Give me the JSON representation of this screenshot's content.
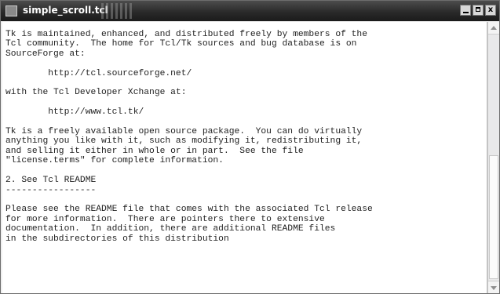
{
  "window": {
    "title": "simple_scroll.tcl",
    "icon": "tk-app-icon",
    "buttons": [
      "minimize",
      "maximize",
      "close"
    ],
    "close_label": "x"
  },
  "text_area": {
    "lines": [
      "Tk is maintained, enhanced, and distributed freely by members of the",
      "Tcl community.  The home for Tcl/Tk sources and bug database is on",
      "SourceForge at:",
      "",
      "        http://tcl.sourceforge.net/",
      "",
      "with the Tcl Developer Xchange at:",
      "",
      "        http://www.tcl.tk/",
      "",
      "Tk is a freely available open source package.  You can do virtually",
      "anything you like with it, such as modifying it, redistributing it,",
      "and selling it either in whole or in part.  See the file",
      "\"license.terms\" for complete information.",
      "",
      "2. See Tcl README",
      "-----------------",
      "",
      "Please see the README file that comes with the associated Tcl release",
      "for more information.  There are pointers there to extensive",
      "documentation.  In addition, there are additional README files",
      "in the subdirectories of this distribution"
    ]
  },
  "scrollbar": {
    "orientation": "vertical",
    "position_fraction": 0.5
  }
}
